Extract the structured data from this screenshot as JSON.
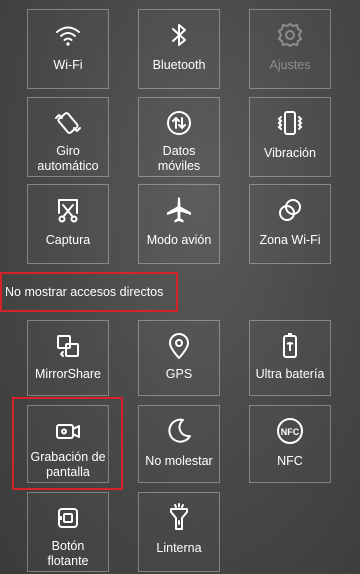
{
  "accent_color": "#d5232c",
  "active_shortcuts": [
    {
      "label": "Wi-Fi",
      "icon": "wifi-icon",
      "enabled": true
    },
    {
      "label": "Bluetooth",
      "icon": "bluetooth-icon",
      "enabled": true
    },
    {
      "label": "Ajustes",
      "icon": "gear-icon",
      "enabled": false
    },
    {
      "label": "Giro automático",
      "icon": "auto-rotate-icon",
      "enabled": true
    },
    {
      "label": "Datos móviles",
      "icon": "mobile-data-icon",
      "enabled": true
    },
    {
      "label": "Vibración",
      "icon": "vibration-icon",
      "enabled": true
    },
    {
      "label": "Captura",
      "icon": "screenshot-scissors-icon",
      "enabled": true
    },
    {
      "label": "Modo avión",
      "icon": "airplane-icon",
      "enabled": true
    },
    {
      "label": "Zona Wi-Fi",
      "icon": "hotspot-icon",
      "enabled": true
    }
  ],
  "hidden_section": {
    "label": "No mostrar accesos directos"
  },
  "hidden_shortcuts": [
    {
      "label": "MirrorShare",
      "icon": "mirrorshare-icon"
    },
    {
      "label": "GPS",
      "icon": "location-pin-icon"
    },
    {
      "label": "Ultra batería",
      "icon": "battery-icon"
    },
    {
      "label": "Grabación de pantalla",
      "icon": "screen-record-icon"
    },
    {
      "label": "No molestar",
      "icon": "moon-icon"
    },
    {
      "label": "NFC",
      "icon": "nfc-icon"
    },
    {
      "label": "Botón flotante",
      "icon": "floating-button-icon"
    },
    {
      "label": "Linterna",
      "icon": "flashlight-icon"
    }
  ]
}
